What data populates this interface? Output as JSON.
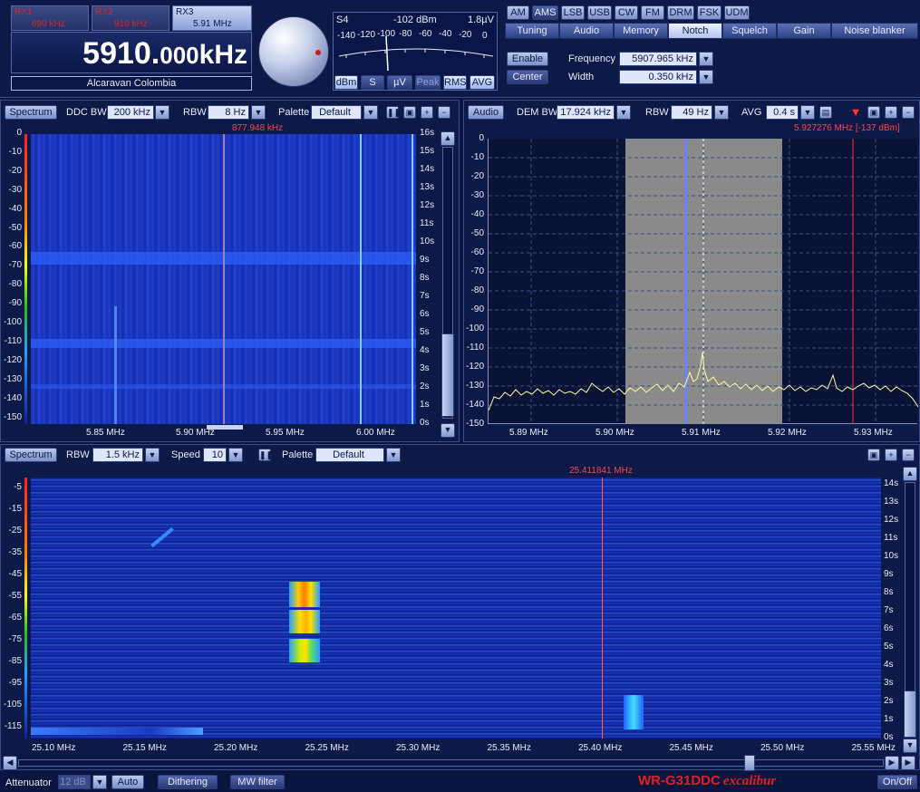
{
  "receivers": [
    {
      "name": "RX1",
      "freq": "690 kHz"
    },
    {
      "name": "RX2",
      "freq": "910 kHz"
    },
    {
      "name": "RX3",
      "freq": "5.91 MHz"
    }
  ],
  "main_freq": {
    "big": "5910.",
    "small": "000",
    "unit": "kHz"
  },
  "station": "Alcaravan Colombia",
  "meter": {
    "s_label": "S4",
    "dbm_value": "-102 dBm",
    "uv_value": "1.8µV",
    "scale": [
      "-140",
      "-120",
      "-100",
      "-80",
      "-60",
      "-40",
      "-20",
      "0"
    ],
    "buttons": [
      "dBm",
      "S",
      "µV",
      "Peak",
      "RMS",
      "AVG"
    ]
  },
  "modes": [
    "AM",
    "AMS",
    "LSB",
    "USB",
    "CW",
    "FM",
    "DRM",
    "FSK",
    "UDM"
  ],
  "tabs": [
    "Tuning",
    "Audio",
    "Memory",
    "Notch",
    "Squelch",
    "Gain",
    "Noise blanker"
  ],
  "notch": {
    "enable_label": "Enable",
    "center_label": "Center",
    "freq_label": "Frequency",
    "freq_value": "5907.965 kHz",
    "width_label": "Width",
    "width_value": "0.350 kHz"
  },
  "left_spec": {
    "title": "Spectrum",
    "ddc_label": "DDC BW",
    "ddc_value": "200 kHz",
    "rbw_label": "RBW",
    "rbw_value": "8 Hz",
    "palette_label": "Palette",
    "palette_value": "Default",
    "marker": "877.948 kHz",
    "y_ticks": [
      "0",
      "-10",
      "-20",
      "-30",
      "-40",
      "-50",
      "-60",
      "-70",
      "-80",
      "-90",
      "-100",
      "-110",
      "-120",
      "-130",
      "-140",
      "-150"
    ],
    "time_ticks": [
      "16s",
      "15s",
      "14s",
      "13s",
      "12s",
      "11s",
      "10s",
      "9s",
      "8s",
      "7s",
      "6s",
      "5s",
      "4s",
      "3s",
      "2s",
      "1s",
      "0s"
    ],
    "x_ticks": [
      "5.85 MHz",
      "5.90 MHz",
      "5.95 MHz",
      "6.00 MHz"
    ]
  },
  "audio": {
    "title": "Audio",
    "dembw_label": "DEM BW",
    "dembw_value": "17.924 kHz",
    "rbw_label": "RBW",
    "rbw_value": "49 Hz",
    "avg_label": "AVG",
    "avg_value": "0.4 s",
    "marker": "5.927276 MHz [-137 dBm]",
    "y_ticks": [
      "0",
      "-10",
      "-20",
      "-30",
      "-40",
      "-50",
      "-60",
      "-70",
      "-80",
      "-90",
      "-100",
      "-110",
      "-120",
      "-130",
      "-140",
      "-150"
    ],
    "x_ticks": [
      "5.89 MHz",
      "5.90 MHz",
      "5.91 MHz",
      "5.92 MHz",
      "5.93 MHz"
    ]
  },
  "bottom": {
    "title": "Spectrum",
    "rbw_label": "RBW",
    "rbw_value": "1.5 kHz",
    "speed_label": "Speed",
    "speed_value": "10",
    "palette_label": "Palette",
    "palette_value": "Default",
    "marker": "25.411841 MHz",
    "y_ticks": [
      "-5",
      "-15",
      "-25",
      "-35",
      "-45",
      "-55",
      "-65",
      "-75",
      "-85",
      "-95",
      "-105",
      "-115"
    ],
    "time_ticks": [
      "14s",
      "13s",
      "12s",
      "11s",
      "10s",
      "9s",
      "8s",
      "7s",
      "6s",
      "5s",
      "4s",
      "3s",
      "2s",
      "1s",
      "0s"
    ],
    "x_ticks": [
      "25.10 MHz",
      "25.15 MHz",
      "25.20 MHz",
      "25.25 MHz",
      "25.30 MHz",
      "25.35 MHz",
      "25.40 MHz",
      "25.45 MHz",
      "25.50 MHz",
      "25.55 MHz"
    ]
  },
  "status": {
    "attenuator_label": "Attenuator",
    "attenuator_value": "12 dB",
    "auto_label": "Auto",
    "dithering_label": "Dithering",
    "mw_label": "MW filter",
    "brand": "WR-G31DDC",
    "brand_sub": "excalibur",
    "power_label": "On/Off"
  }
}
